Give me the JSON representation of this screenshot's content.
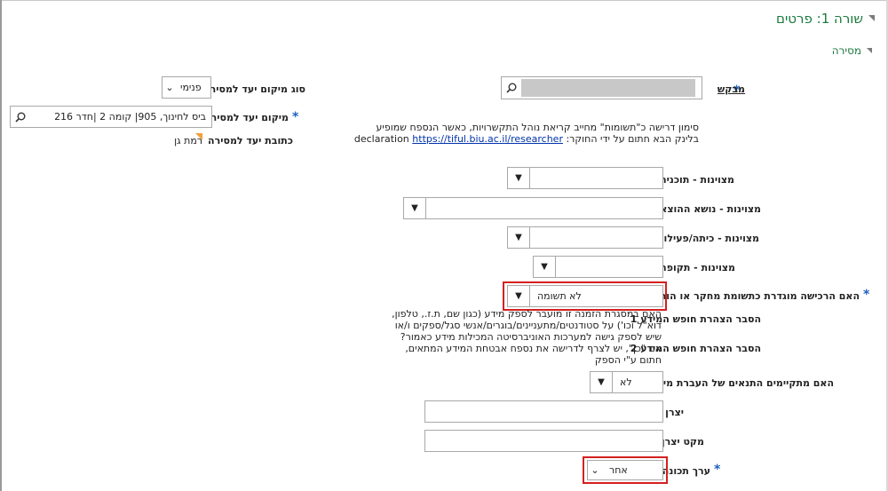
{
  "section": {
    "title": "שורה 1: פרטים",
    "sub": "מסירה"
  },
  "requester": {
    "label": "מבקש"
  },
  "delivery_location_type": {
    "label": "סוג מיקום יעד למסירה",
    "value": "פנימי"
  },
  "delivery_location": {
    "label": "מיקום יעד למסירה",
    "value": "ביס לחינוך, 905| קומה 2 |חדר 216"
  },
  "delivery_address": {
    "label": "כתובת יעד למסירה",
    "value": "רמת גן"
  },
  "answer_note": {
    "line1": "סימון דרישה כ\"תשומות\" מחייב קריאת נוהל התקשרויות, כאשר הנספח שמופיע",
    "line2": "בלינק הבא חתום על ידי החוקר: declaration",
    "link": "https://tiful.biu.ac.il/researcher"
  },
  "fields": {
    "excellence_program": "מצוינות - תוכנית",
    "excellence_expense": "מצוינות - נושא ההוצאה",
    "excellence_class": "מצוינות - כיתה/פעילות",
    "excellence_period": "מצוינות - תקופה",
    "research_input": {
      "label": "האם הרכישה מוגדרת כתשומת מחקר או הוראה?",
      "value": "לא תשומה"
    },
    "privacy1": {
      "label": "הסבר הצהרת חופש המידע 1",
      "text": "האם במסגרת הזמנה זו מועבר לספק מידע (כגון שם, ת.ז., טלפון, דוא\"ל וכו') על סטודנטים/מתעניינים/בוגרים/אנשי סגל/ספקים ו/או"
    },
    "privacy2": {
      "label": "הסבר הצהרת חופש המידע 2",
      "text": "שיש לספק גישה למערכות האוניברסיטה המכילות מידע כאמור? אם \"כן\", יש לצרף לדרישה את נספח אבטחת המידע המתאים, חתום ע\"י הספק"
    },
    "info_transfer": {
      "label": "האם מתקיימים התנאים של העברת מידע?",
      "value": "לא"
    },
    "manufacturer": "יצרן",
    "manufacturer_sku": "מקט יצרן",
    "attribute_value": {
      "label": "ערך תכונה",
      "value": "אחר"
    }
  },
  "icons": {
    "dropdown": "caret-down-icon",
    "search": "search-icon",
    "expand": "triangle-expand-icon",
    "flag": "flag-icon"
  }
}
